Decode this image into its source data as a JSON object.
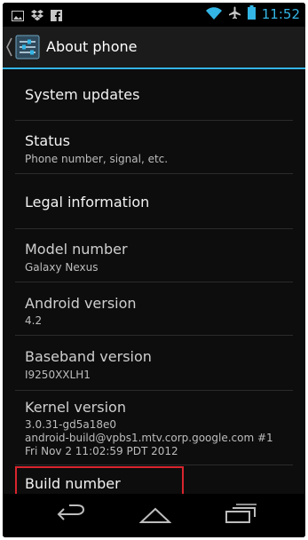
{
  "status_bar": {
    "time": "11:52",
    "left_icons": [
      "image-icon",
      "dropbox-icon",
      "facebook-icon"
    ],
    "right_icons": [
      "wifi-icon",
      "airplane-icon",
      "battery-icon"
    ]
  },
  "action_bar": {
    "title": "About phone",
    "icon": "settings-icon",
    "accent_color": "#33b5e5"
  },
  "preferences": [
    {
      "id": "system-updates",
      "title": "System updates",
      "summary": ""
    },
    {
      "id": "status",
      "title": "Status",
      "summary": "Phone number, signal, etc."
    },
    {
      "id": "legal-information",
      "title": "Legal information",
      "summary": ""
    },
    {
      "id": "model-number",
      "title": "Model number",
      "summary": "Galaxy Nexus"
    },
    {
      "id": "android-version",
      "title": "Android version",
      "summary": "4.2"
    },
    {
      "id": "baseband-version",
      "title": "Baseband version",
      "summary": "I9250XXLH1"
    },
    {
      "id": "kernel-version",
      "title": "Kernel version",
      "summary_lines": [
        "3.0.31-gd5a18e0",
        "android-build@vpbs1.mtv.corp.google.com #1",
        "Fri Nov 2 11:02:59 PDT 2012"
      ]
    },
    {
      "id": "build-number",
      "title": "Build number",
      "summary": ""
    }
  ],
  "highlight_color": "#d9252e",
  "nav_bar": {
    "buttons": [
      "back-icon",
      "home-icon",
      "recent-apps-icon"
    ]
  }
}
